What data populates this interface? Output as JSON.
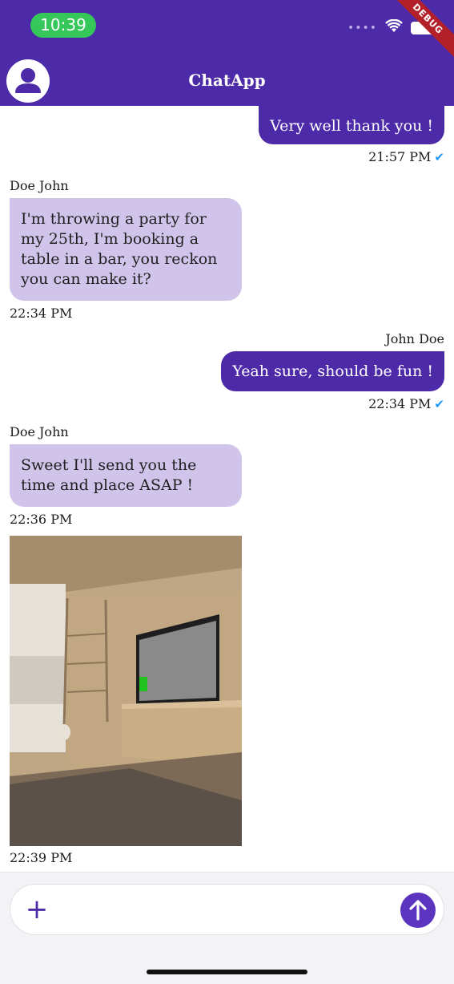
{
  "status_bar": {
    "time": "10:39",
    "signal_dots": "••••",
    "debug_label": "DEBUG"
  },
  "app_bar": {
    "title": "ChatApp"
  },
  "messages": [
    {
      "direction": "outgoing",
      "sender": "",
      "text": "Very well thank you !",
      "time": "21:57 PM",
      "read": true
    },
    {
      "direction": "incoming",
      "sender": "Doe John",
      "text": "I'm throwing a party for my 25th, I'm booking a table in a bar, you reckon you can make it?",
      "time": "22:34 PM"
    },
    {
      "direction": "outgoing",
      "sender": "John Doe",
      "text": "Yeah sure, should be fun !",
      "time": "22:34 PM",
      "read": true
    },
    {
      "direction": "incoming",
      "sender": "Doe John",
      "text": "Sweet I'll send you the time and place ASAP !",
      "time": "22:36 PM"
    },
    {
      "direction": "incoming",
      "sender": "",
      "image": "room-photo",
      "time": "22:39 PM"
    }
  ],
  "composer": {
    "placeholder": "",
    "add_icon": "plus-icon",
    "send_icon": "arrow-up-icon"
  },
  "colors": {
    "primary": "#4c2aa8",
    "incoming_bubble": "#d0c4ea",
    "read_tick": "#2196f3",
    "time_pill": "#35c759"
  }
}
